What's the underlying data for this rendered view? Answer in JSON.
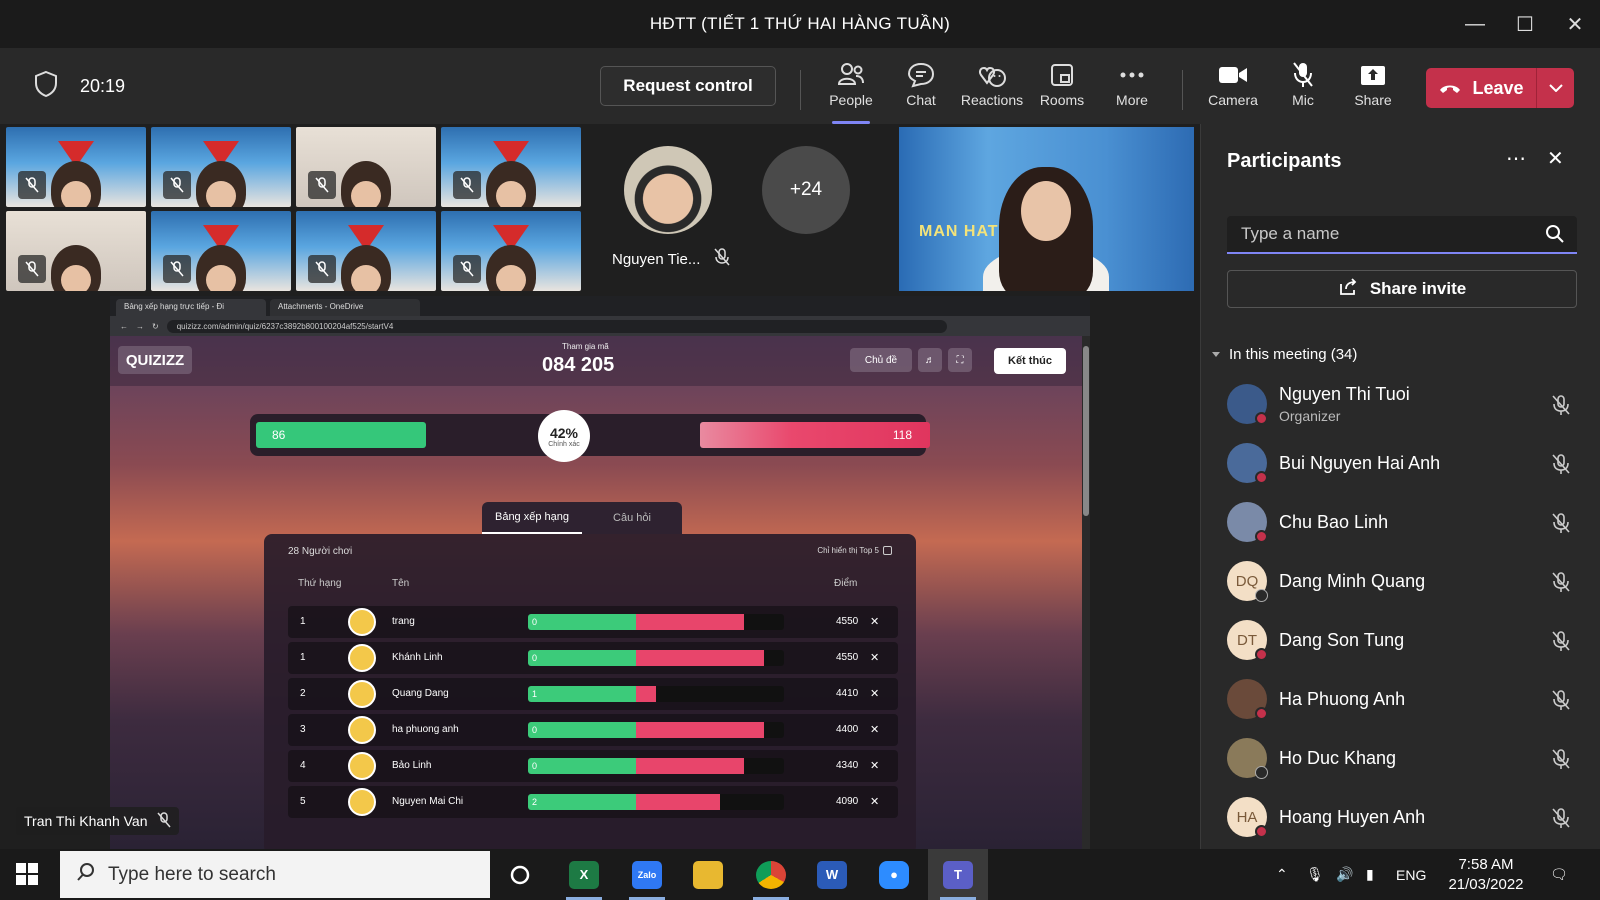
{
  "window": {
    "title": "HĐTT (TIẾT 1 THỨ HAI HÀNG TUẦN)"
  },
  "toolbar": {
    "timer": "20:19",
    "request_control": "Request control",
    "people": "People",
    "chat": "Chat",
    "reactions": "Reactions",
    "rooms": "Rooms",
    "more": "More",
    "camera": "Camera",
    "mic": "Mic",
    "share": "Share",
    "leave": "Leave"
  },
  "stage": {
    "featured_name": "Nguyen Tie...",
    "overflow_count": "+24",
    "banner_text": "MAN      HAT ĐẢN ỤT",
    "speaker_tag": "Tran Thi Khanh Van"
  },
  "browser": {
    "tabs": [
      "Bảng xếp hạng trực tiếp - Đi",
      "Attachments - OneDrive"
    ],
    "url": "quizizz.com/admin/quiz/6237c3892b800100204af525/startV4"
  },
  "quizizz": {
    "logo": "QUIZIZZ",
    "join_label": "Tham gia mã",
    "join_code": "084 205",
    "theme_btn": "Chủ đề",
    "end_btn": "Kết thúc",
    "correct_count": "86",
    "incorrect_count": "118",
    "accuracy": "42%",
    "accuracy_label": "Chính xác",
    "correct_fraction": 0.42,
    "tab_leaderboard": "Bảng xếp hạng",
    "tab_questions": "Câu hỏi",
    "players": "28 Người chơi",
    "top5_label": "Chỉ hiển thị Top 5",
    "col_rank": "Thứ hạng",
    "col_name": "Tên",
    "col_score": "Điểm",
    "rows": [
      {
        "rank": "1",
        "name": "trang",
        "streak": "0",
        "correct": 0.42,
        "incorrect": 0.42,
        "score": "4550"
      },
      {
        "rank": "1",
        "name": "Khánh Linh",
        "streak": "0",
        "correct": 0.42,
        "incorrect": 0.5,
        "score": "4550"
      },
      {
        "rank": "2",
        "name": "Quang Dang",
        "streak": "1",
        "correct": 0.42,
        "incorrect": 0.08,
        "score": "4410"
      },
      {
        "rank": "3",
        "name": "ha phuong anh",
        "streak": "0",
        "correct": 0.42,
        "incorrect": 0.5,
        "score": "4400"
      },
      {
        "rank": "4",
        "name": "Bảo Linh",
        "streak": "0",
        "correct": 0.42,
        "incorrect": 0.42,
        "score": "4340"
      },
      {
        "rank": "5",
        "name": "Nguyen Mai Chi",
        "streak": "2",
        "correct": 0.42,
        "incorrect": 0.33,
        "score": "4090"
      }
    ]
  },
  "participants": {
    "title": "Participants",
    "search_placeholder": "Type a name",
    "share_invite": "Share invite",
    "in_meeting": "In this meeting (34)",
    "people": [
      {
        "name": "Nguyen Thi Tuoi",
        "role": "Organizer",
        "initials": ""
      },
      {
        "name": "Bui Nguyen Hai Anh",
        "role": "",
        "initials": ""
      },
      {
        "name": "Chu Bao Linh",
        "role": "",
        "initials": ""
      },
      {
        "name": "Dang Minh Quang",
        "role": "",
        "initials": "DQ"
      },
      {
        "name": "Dang Son Tung",
        "role": "",
        "initials": "DT"
      },
      {
        "name": "Ha Phuong Anh",
        "role": "",
        "initials": ""
      },
      {
        "name": "Ho Duc Khang",
        "role": "",
        "initials": ""
      },
      {
        "name": "Hoang Huyen Anh",
        "role": "",
        "initials": "HA"
      }
    ]
  },
  "taskbar": {
    "search_placeholder": "Type here to search",
    "lang": "ENG",
    "time": "7:58 AM",
    "date": "21/03/2022"
  },
  "colors": {
    "accent": "#7f85f5",
    "leave": "#c4314b",
    "correct": "#3ccb7a",
    "incorrect": "#e8456b"
  }
}
